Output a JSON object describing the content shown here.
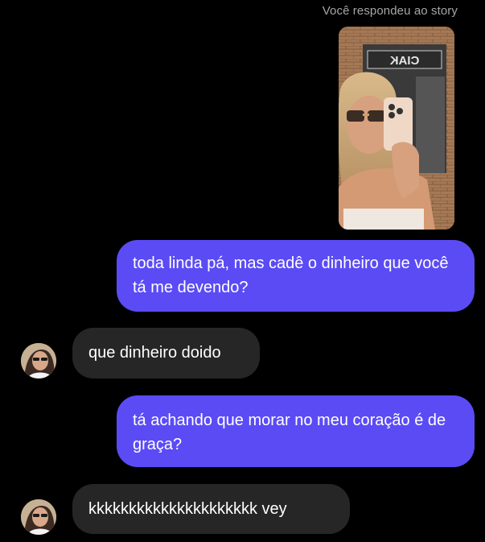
{
  "story": {
    "caption": "Você respondeu ao story",
    "sign_text": "CIAK"
  },
  "messages": [
    {
      "from": "me",
      "text": "toda linda pá, mas cadê o dinheiro que você tá me devendo?"
    },
    {
      "from": "them",
      "text": "que dinheiro doido"
    },
    {
      "from": "me",
      "text": "tá achando que morar no meu coração é de graça?"
    },
    {
      "from": "them",
      "text": "kkkkkkkkkkkkkkkkkkkkk vey"
    }
  ],
  "colors": {
    "background": "#000000",
    "sent_bubble": "#5b4bf5",
    "received_bubble": "#262626",
    "caption": "#a6a6a6"
  }
}
